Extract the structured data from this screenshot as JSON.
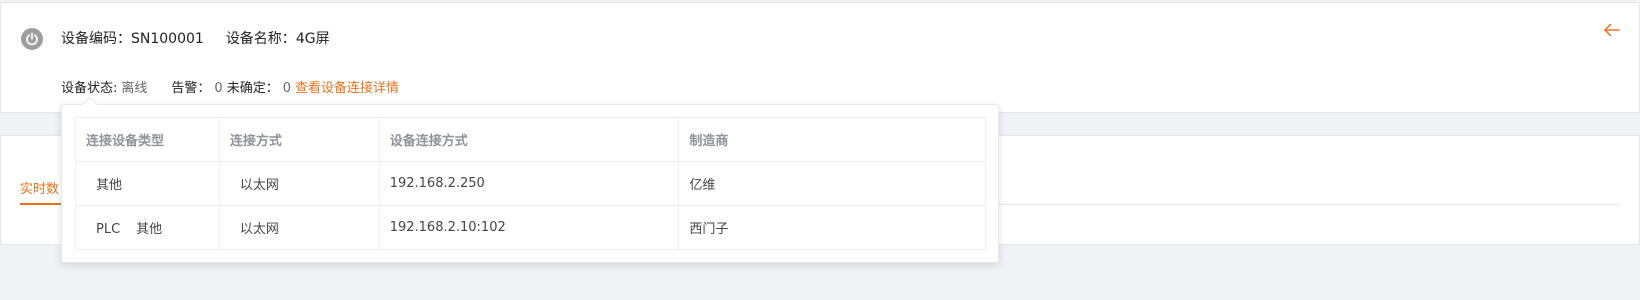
{
  "device": {
    "code_label": "设备编码：",
    "code_value": "SN100001",
    "name_label": "设备名称：",
    "name_value": "4G屏"
  },
  "status": {
    "state_label": "设备状态:",
    "state_value": "离线",
    "alarm_label": "告警：",
    "alarm_value": "0",
    "unconfirmed_label": "未确定：",
    "unconfirmed_value": "0",
    "details_link": "查看设备连接详情"
  },
  "tabs": {
    "active_label": "实时数"
  },
  "connections": {
    "headers": [
      "连接设备类型",
      "连接方式",
      "设备连接方式",
      "制造商"
    ],
    "rows": [
      {
        "type": "其他",
        "type_prefix": "",
        "method": "以太网",
        "address": "192.168.2.250",
        "maker": "亿维"
      },
      {
        "type": "其他",
        "type_prefix": "PLC",
        "method": "以太网",
        "address": "192.168.2.10:102",
        "maker": "西门子"
      }
    ]
  },
  "colors": {
    "accent": "#e8741f",
    "background": "#f0f2f5",
    "icon_gray": "#9e9e9e"
  }
}
